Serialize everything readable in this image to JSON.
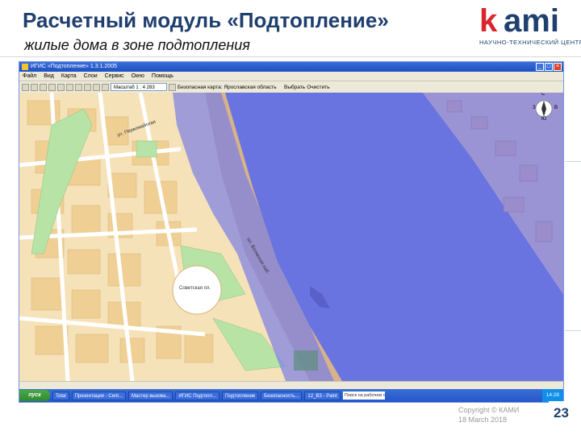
{
  "slide": {
    "title": "Расчетный модуль «Подтопление»",
    "subtitle": "жилые дома в зоне подтопления",
    "logo_text": "kami",
    "logo_sub": "НАУЧНО-ТЕХНИЧЕСКИЙ ЦЕНТР",
    "copyright": "Copyright © КАМИ",
    "date": "18 March 2018",
    "page_number": "23"
  },
  "window": {
    "title": "ИГИС «Подтопление» 1.3.1.2005",
    "menu": [
      "Файл",
      "Вид",
      "Карта",
      "Слои",
      "Сервис",
      "Окно",
      "Помощь"
    ],
    "toolbar": {
      "scale_label": "Масштаб 1 : 4 283",
      "layer_text": "Безопасная карта: Ярославская область",
      "btn_find": "Выбрать",
      "btn_clear": "Очистить"
    }
  },
  "map": {
    "compass": {
      "n": "С",
      "s": "Ю",
      "w": "З",
      "e": "В"
    },
    "labels": [
      "ул. Первомайская",
      "Советская пл.",
      "пл. Волжская наб."
    ],
    "colors": {
      "land": "#f6e2b8",
      "flood": "#6a74e0",
      "park": "#b7e3a6",
      "road": "#ffffff"
    }
  },
  "taskbar": {
    "start": "пуск",
    "items": [
      "Total",
      "Презентация - Cent...",
      "Мастер вызова...",
      "ИГИС Подтопл...",
      "Подтопление",
      "Безопасность...",
      "12_ВЗ - Paint"
    ],
    "search_text": "Поиск на рабочем столе",
    "clock": "14:28"
  },
  "colors": {
    "title": "#1f3f6e",
    "accent": "#d9262c"
  }
}
